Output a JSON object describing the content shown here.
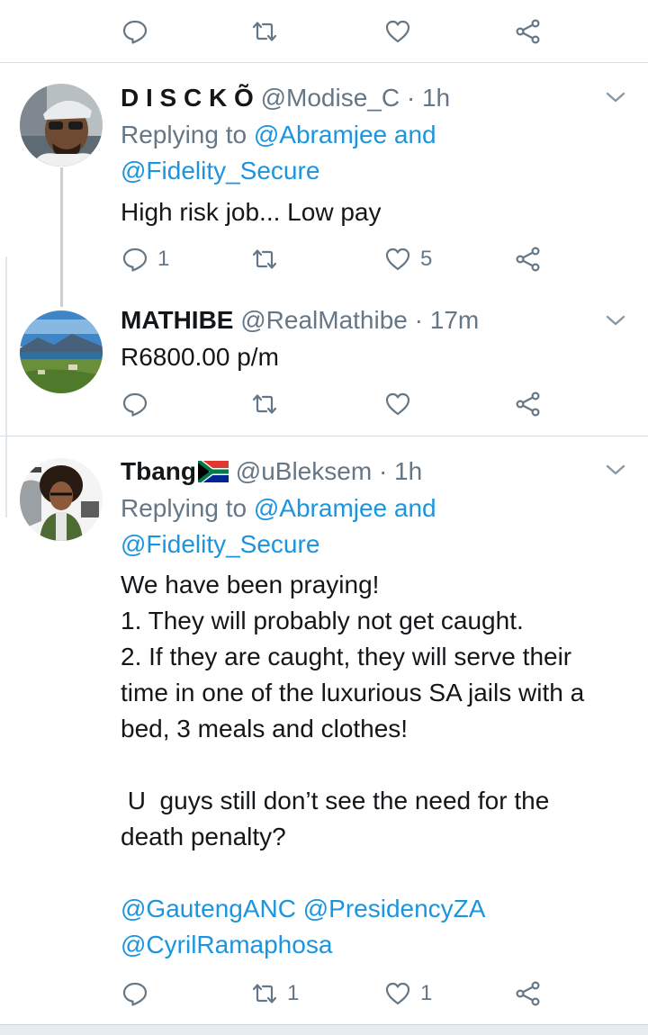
{
  "top_actions": {
    "reply": "",
    "retweet": "",
    "like": ""
  },
  "tweets": [
    {
      "name": "D I S C K Õ",
      "handle": "@Modise_C",
      "time": "· 1h",
      "replying_prefix": "Replying to",
      "replying_first": "@Abramjee and",
      "replying_second": "@Fidelity_Secure",
      "body": [
        "High risk job... Low pay"
      ],
      "reply_count": "1",
      "retweet_count": "",
      "like_count": "5"
    },
    {
      "name": "MATHIBE",
      "handle": "@RealMathibe",
      "time": "· 17m",
      "body": [
        "R6800.00 p/m"
      ],
      "reply_count": "",
      "retweet_count": "",
      "like_count": ""
    },
    {
      "name": "Tbang",
      "flag": "south-africa-flag",
      "handle": "@uBleksem",
      "time": "· 1h",
      "replying_prefix": "Replying to",
      "replying_first": "@Abramjee and",
      "replying_second": "@Fidelity_Secure",
      "body": [
        "We have been praying!",
        "1. They will probably not get caught.",
        "2. If they are caught, they will serve their",
        "time in one of the luxurious SA jails with a",
        "bed, 3 meals and clothes!",
        " U  guys still don’t see the need for the",
        "death penalty?"
      ],
      "mentions": [
        "@GautengANC @PresidencyZA",
        "@CyrilRamaphosa"
      ],
      "reply_count": "",
      "retweet_count": "1",
      "like_count": "1"
    }
  ],
  "colors": {
    "link": "#1b95e0",
    "muted": "#657786",
    "text": "#14171a",
    "divider": "#d8dde2"
  },
  "icons": [
    "reply-icon",
    "retweet-icon",
    "like-icon",
    "share-icon",
    "caret-down-icon"
  ]
}
